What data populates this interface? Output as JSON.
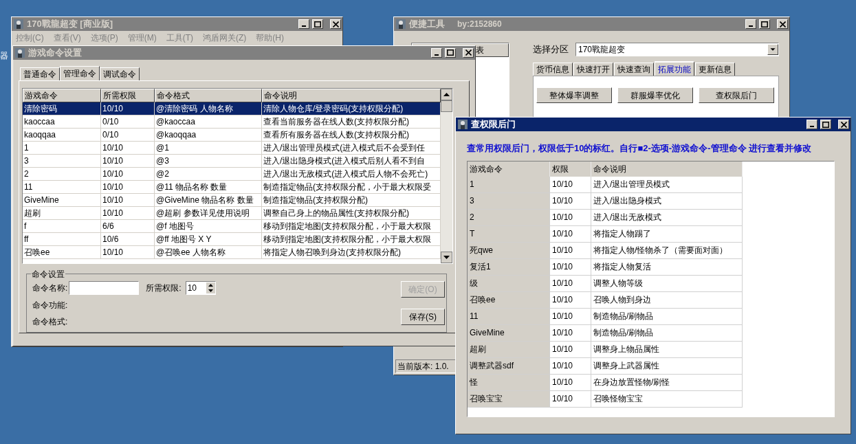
{
  "desktop": {
    "edge_text": "器"
  },
  "main_window": {
    "title": "170戰龍超变 [商业版]",
    "active": false,
    "menu": [
      "控制(C)",
      "查看(V)",
      "选项(P)",
      "管理(M)",
      "工具(T)",
      "鸿盾网关(Z)",
      "帮助(H)"
    ]
  },
  "command_dialog": {
    "title": "游戏命令设置",
    "active": false,
    "tabs": [
      {
        "label": "普通命令",
        "selected": false
      },
      {
        "label": "管理命令",
        "selected": true
      },
      {
        "label": "调试命令",
        "selected": false
      }
    ],
    "table": {
      "columns": [
        "游戏命令",
        "所需权限",
        "命令格式",
        "命令说明"
      ],
      "rows": [
        {
          "cells": [
            "清除密码",
            "10/10",
            "@清除密码 人物名称",
            "清除人物仓库/登录密码(支持权限分配)"
          ],
          "selected": true
        },
        {
          "cells": [
            "kaoccaa",
            "0/10",
            "@kaoccaa",
            "查看当前服务器在线人数(支持权限分配)"
          ],
          "selected": false
        },
        {
          "cells": [
            "kaoqqaa",
            "0/10",
            "@kaoqqaa",
            "查看所有服务器在线人数(支持权限分配)"
          ],
          "selected": false
        },
        {
          "cells": [
            "1",
            "10/10",
            "@1",
            "进入/退出管理员模式(进入模式后不会受到任"
          ],
          "selected": false
        },
        {
          "cells": [
            "3",
            "10/10",
            "@3",
            "进入/退出隐身模式(进入模式后别人看不到自"
          ],
          "selected": false
        },
        {
          "cells": [
            "2",
            "10/10",
            "@2",
            "进入/退出无敌模式(进入模式后人物不会死亡)"
          ],
          "selected": false
        },
        {
          "cells": [
            "11",
            "10/10",
            "@11 物品名称 数量",
            "制造指定物品(支持权限分配，小于最大权限受"
          ],
          "selected": false
        },
        {
          "cells": [
            "GiveMine",
            "10/10",
            "@GiveMine 物品名称 数量",
            "制造指定物品(支持权限分配)"
          ],
          "selected": false
        },
        {
          "cells": [
            "超刷",
            "10/10",
            "@超刷 参数详见使用说明",
            "调整自己身上的物品属性(支持权限分配)"
          ],
          "selected": false
        },
        {
          "cells": [
            "f",
            "6/6",
            "@f 地图号",
            "移动到指定地图(支持权限分配，小于最大权限"
          ],
          "selected": false
        },
        {
          "cells": [
            "ff",
            "10/6",
            "@ff 地图号 X Y",
            "移动到指定地图(支持权限分配，小于最大权限"
          ],
          "selected": false
        },
        {
          "cells": [
            "召唤ee",
            "10/10",
            "@召唤ee 人物名称",
            "将指定人物召唤到身边(支持权限分配)"
          ],
          "selected": false
        }
      ]
    },
    "settings": {
      "title": "命令设置",
      "name_label": "命令名称:",
      "level_label": "所需权限:",
      "level_value": "10",
      "function_label": "命令功能:",
      "format_label": "命令格式:",
      "buttons": [
        {
          "label": "确定(O)",
          "disabled": true
        },
        {
          "label": "保存(S)",
          "disabled": false
        }
      ]
    }
  },
  "quick_tool": {
    "title": "便捷工具",
    "author": "by:2152860",
    "active": false,
    "list_header": "表",
    "zone_label": "选择分区",
    "zone_value": "170戰龍超变",
    "tabs": [
      {
        "label": "货币信息",
        "selected": false
      },
      {
        "label": "快速打开",
        "selected": false
      },
      {
        "label": "快速查询",
        "selected": false
      },
      {
        "label": "拓展功能",
        "selected": true
      },
      {
        "label": "更新信息",
        "selected": false
      }
    ],
    "buttons": [
      "整体爆率调整",
      "群服爆率优化",
      "查权限后门"
    ],
    "status": "当前版本: 1.0."
  },
  "backdoor": {
    "title": "查权限后门",
    "active": true,
    "notice": "查常用权限后门，权限低于10的标红。自行■2-选项-游戏命令-管理命令 进行查看并修改",
    "table": {
      "columns": [
        "游戏命令",
        "权限",
        "命令说明"
      ],
      "rows": [
        [
          "1",
          "10/10",
          "进入/退出管理员模式"
        ],
        [
          "3",
          "10/10",
          "进入/退出隐身模式"
        ],
        [
          "2",
          "10/10",
          "进入/退出无敌模式"
        ],
        [
          "T",
          "10/10",
          "将指定人物踢了"
        ],
        [
          "死qwe",
          "10/10",
          "将指定人物/怪物杀了（需要面对面）"
        ],
        [
          "复活1",
          "10/10",
          "将指定人物复活"
        ],
        [
          "级",
          "10/10",
          "调整人物等级"
        ],
        [
          "召唤ee",
          "10/10",
          "召唤人物到身边"
        ],
        [
          "11",
          "10/10",
          "制造物品/刷物品"
        ],
        [
          "GiveMine",
          "10/10",
          "制造物品/刷物品"
        ],
        [
          "超刷",
          "10/10",
          "调整身上物品属性"
        ],
        [
          "调整武器sdf",
          "10/10",
          "调整身上武器属性"
        ],
        [
          "怪",
          "10/10",
          "在身边放置怪物/刷怪"
        ],
        [
          "召唤宝宝",
          "10/10",
          "召唤怪物宝宝"
        ]
      ]
    }
  }
}
